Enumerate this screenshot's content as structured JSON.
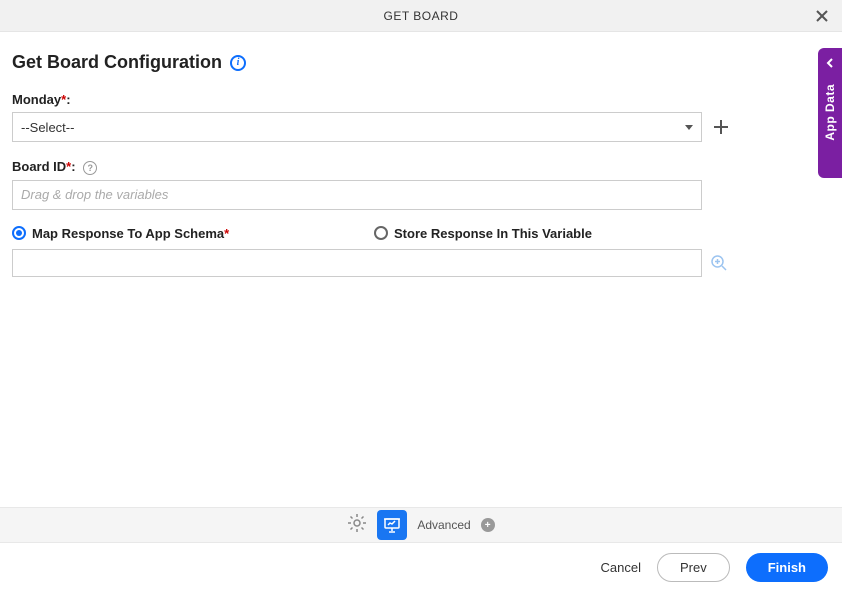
{
  "header": {
    "title": "GET BOARD"
  },
  "page": {
    "title": "Get Board Configuration"
  },
  "fields": {
    "monday": {
      "label": "Monday",
      "selected": "--Select--"
    },
    "board_id": {
      "label": "Board ID",
      "placeholder": "Drag & drop the variables"
    }
  },
  "radios": {
    "map_schema": "Map Response To App Schema",
    "store_var": "Store Response In This Variable"
  },
  "toolbar": {
    "advanced": "Advanced"
  },
  "footer": {
    "cancel": "Cancel",
    "prev": "Prev",
    "finish": "Finish"
  },
  "side": {
    "label": "App Data"
  }
}
